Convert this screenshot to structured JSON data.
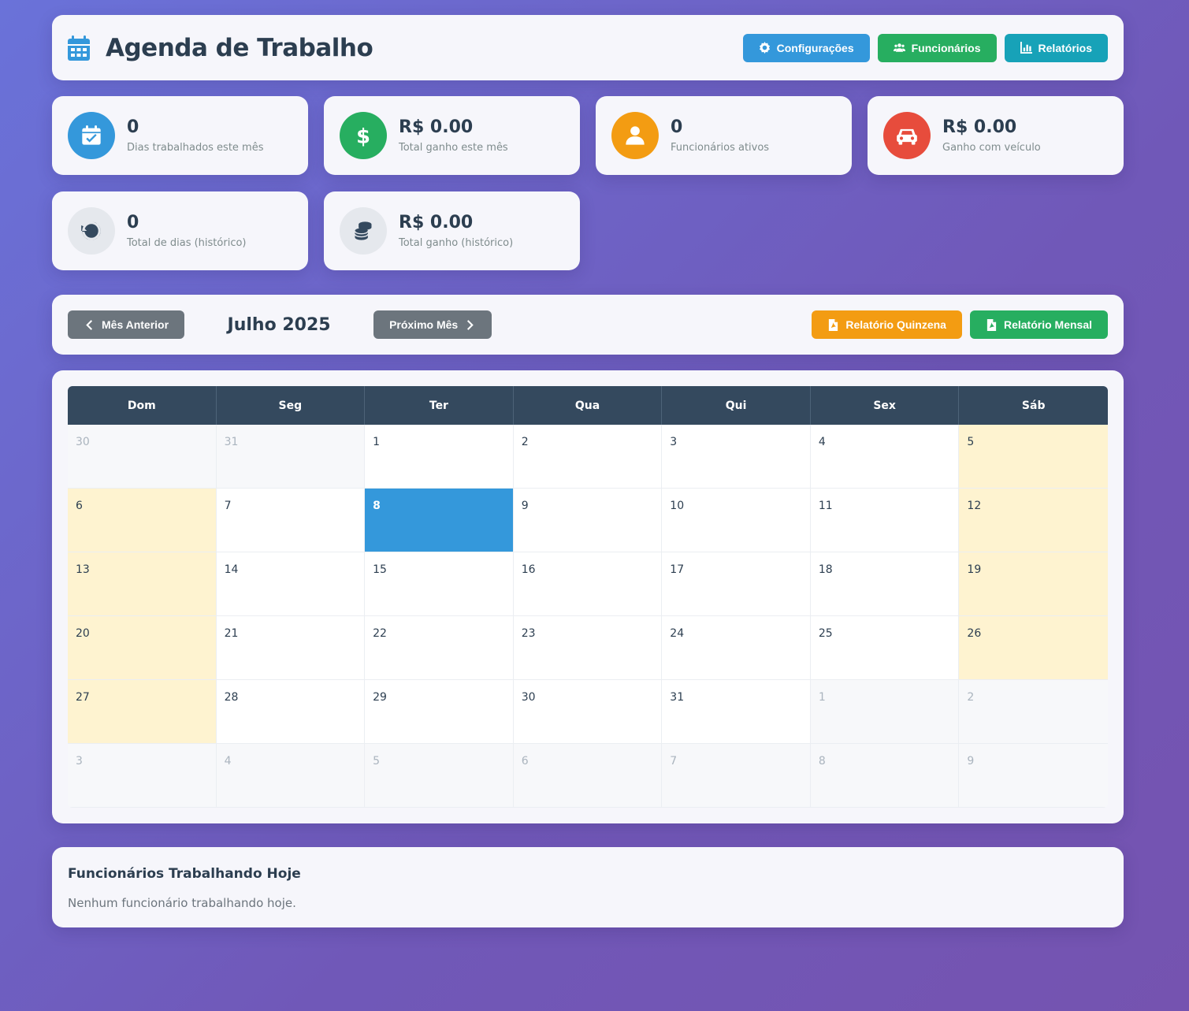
{
  "header": {
    "title": "Agenda de Trabalho",
    "buttons": {
      "settings": "Configurações",
      "employees": "Funcionários",
      "reports": "Relatórios"
    }
  },
  "stats": [
    {
      "value": "0",
      "label": "Dias trabalhados este mês",
      "color": "#3498db",
      "icon": "calendar-check-icon"
    },
    {
      "value": "R$ 0.00",
      "label": "Total ganho este mês",
      "color": "#27ae60",
      "icon": "dollar-icon"
    },
    {
      "value": "0",
      "label": "Funcionários ativos",
      "color": "#f39c12",
      "icon": "user-icon"
    },
    {
      "value": "R$ 0.00",
      "label": "Ganho com veículo",
      "color": "#e74c3c",
      "icon": "car-icon"
    },
    {
      "value": "0",
      "label": "Total de dias (histórico)",
      "color": "#e5e8ed",
      "icon": "history-icon"
    },
    {
      "value": "R$ 0.00",
      "label": "Total ganho (histórico)",
      "color": "#e5e8ed",
      "icon": "coins-icon"
    }
  ],
  "nav": {
    "prev": "Mês Anterior",
    "month": "Julho 2025",
    "next": "Próximo Mês",
    "report_fortnight": "Relatório Quinzena",
    "report_monthly": "Relatório Mensal"
  },
  "calendar": {
    "weekdays": [
      "Dom",
      "Seg",
      "Ter",
      "Qua",
      "Qui",
      "Sex",
      "Sáb"
    ],
    "today": 8,
    "days": [
      {
        "n": "30",
        "t": "other"
      },
      {
        "n": "31",
        "t": "other"
      },
      {
        "n": "1",
        "t": ""
      },
      {
        "n": "2",
        "t": ""
      },
      {
        "n": "3",
        "t": ""
      },
      {
        "n": "4",
        "t": ""
      },
      {
        "n": "5",
        "t": "weekend"
      },
      {
        "n": "6",
        "t": "weekend"
      },
      {
        "n": "7",
        "t": ""
      },
      {
        "n": "8",
        "t": "today"
      },
      {
        "n": "9",
        "t": ""
      },
      {
        "n": "10",
        "t": ""
      },
      {
        "n": "11",
        "t": ""
      },
      {
        "n": "12",
        "t": "weekend"
      },
      {
        "n": "13",
        "t": "weekend"
      },
      {
        "n": "14",
        "t": ""
      },
      {
        "n": "15",
        "t": ""
      },
      {
        "n": "16",
        "t": ""
      },
      {
        "n": "17",
        "t": ""
      },
      {
        "n": "18",
        "t": ""
      },
      {
        "n": "19",
        "t": "weekend"
      },
      {
        "n": "20",
        "t": "weekend"
      },
      {
        "n": "21",
        "t": ""
      },
      {
        "n": "22",
        "t": ""
      },
      {
        "n": "23",
        "t": ""
      },
      {
        "n": "24",
        "t": ""
      },
      {
        "n": "25",
        "t": ""
      },
      {
        "n": "26",
        "t": "weekend"
      },
      {
        "n": "27",
        "t": "weekend"
      },
      {
        "n": "28",
        "t": ""
      },
      {
        "n": "29",
        "t": ""
      },
      {
        "n": "30",
        "t": ""
      },
      {
        "n": "31",
        "t": ""
      },
      {
        "n": "1",
        "t": "other"
      },
      {
        "n": "2",
        "t": "other"
      },
      {
        "n": "3",
        "t": "other"
      },
      {
        "n": "4",
        "t": "other"
      },
      {
        "n": "5",
        "t": "other"
      },
      {
        "n": "6",
        "t": "other"
      },
      {
        "n": "7",
        "t": "other"
      },
      {
        "n": "8",
        "t": "other"
      },
      {
        "n": "9",
        "t": "other"
      }
    ]
  },
  "today_panel": {
    "title": "Funcionários Trabalhando Hoje",
    "empty": "Nenhum funcionário trabalhando hoje."
  }
}
